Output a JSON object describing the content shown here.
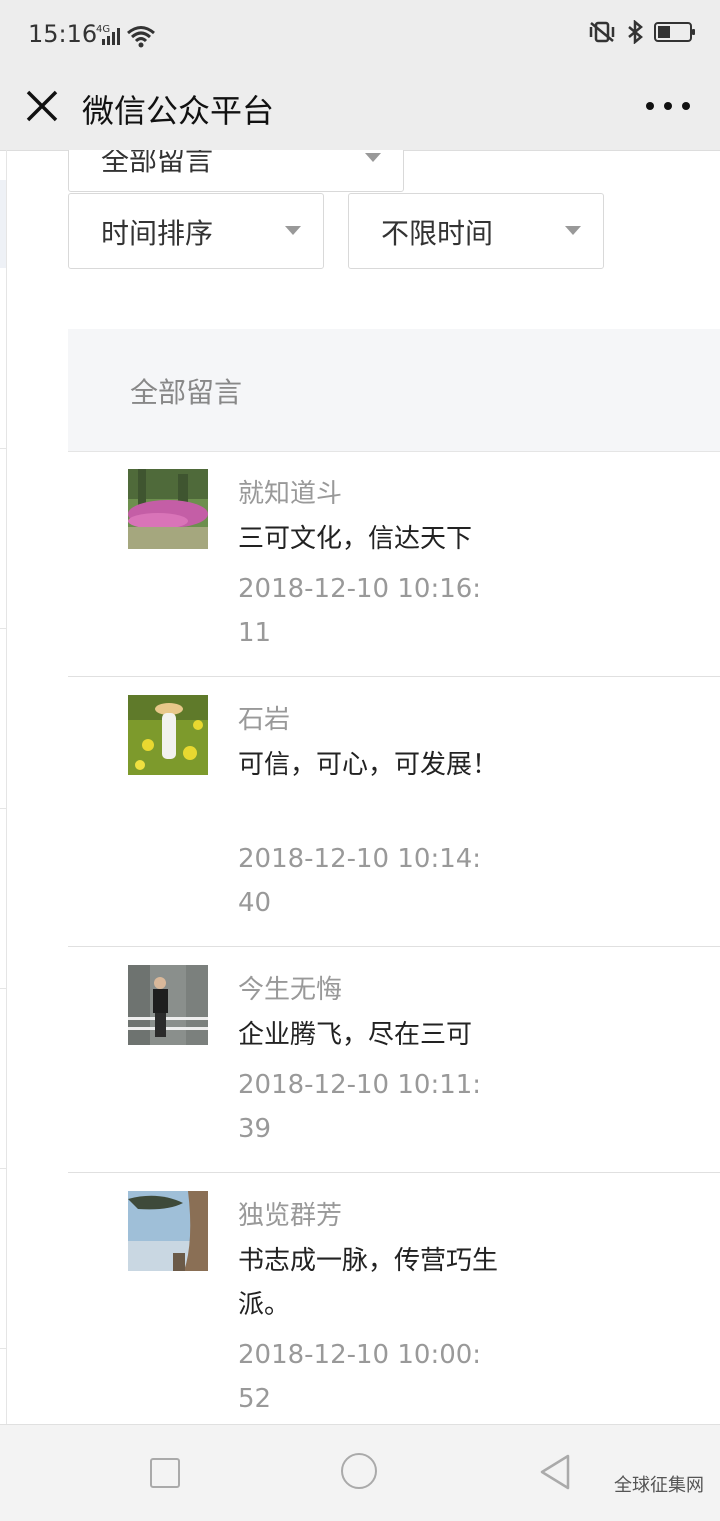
{
  "status_bar": {
    "time": "15:16",
    "network": "4G"
  },
  "nav": {
    "title": "微信公众平台"
  },
  "filters": {
    "category": "全部留言",
    "sort": "时间排序",
    "time_range": "不限时间"
  },
  "section_title": "全部留言",
  "comments": [
    {
      "name": "就知道斗",
      "text": "三可文化，信达天下",
      "time": "2018-12-10 10:16:11"
    },
    {
      "name": "石岩",
      "text": "可信，可心，可发展！",
      "time": "2018-12-10 10:14:40"
    },
    {
      "name": "今生无悔",
      "text": "企业腾飞，尽在三可",
      "time": "2018-12-10 10:11:39"
    },
    {
      "name": "独览群芳",
      "text": "书志成一脉，传营巧生派。",
      "time": "2018-12-10 10:00:52"
    }
  ],
  "watermark": "全球征集网"
}
